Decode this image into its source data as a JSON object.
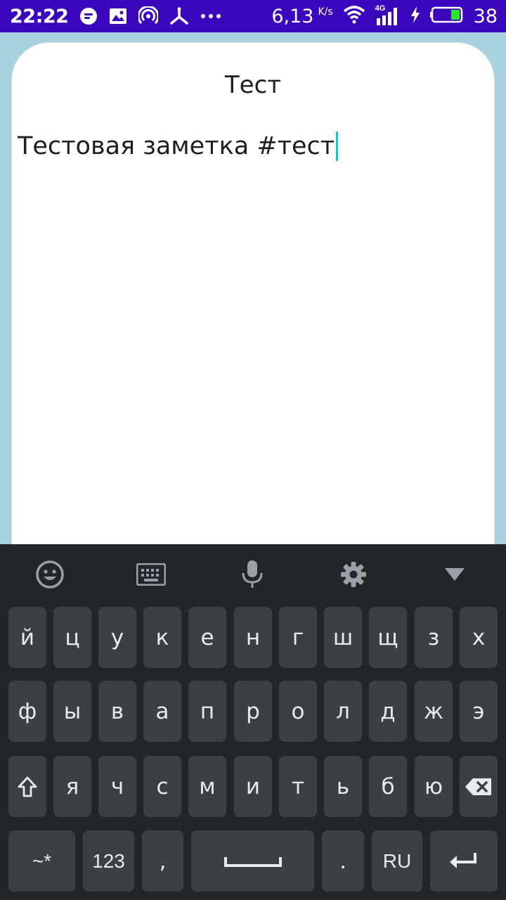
{
  "status_bar": {
    "time": "22:22",
    "speed": "6,13",
    "speed_unit": "K/s",
    "network": "4G",
    "battery": "38",
    "bg_color": "#3a07bd"
  },
  "note": {
    "title": "Тест",
    "body": "Тестовая заметка #тест"
  },
  "keyboard": {
    "toolbar": [
      "emoji-icon",
      "keyboard-icon",
      "microphone-icon",
      "gear-icon",
      "collapse-icon"
    ],
    "row1": [
      "й",
      "ц",
      "у",
      "к",
      "е",
      "н",
      "г",
      "ш",
      "щ",
      "з",
      "х"
    ],
    "row2": [
      "ф",
      "ы",
      "в",
      "а",
      "п",
      "р",
      "о",
      "л",
      "д",
      "ж",
      "э"
    ],
    "row3": [
      "я",
      "ч",
      "с",
      "м",
      "и",
      "т",
      "ь",
      "б",
      "ю"
    ],
    "symbols_label": "~*",
    "numbers_label": "123",
    "comma_label": ",",
    "period_label": ".",
    "language_label": "RU"
  }
}
